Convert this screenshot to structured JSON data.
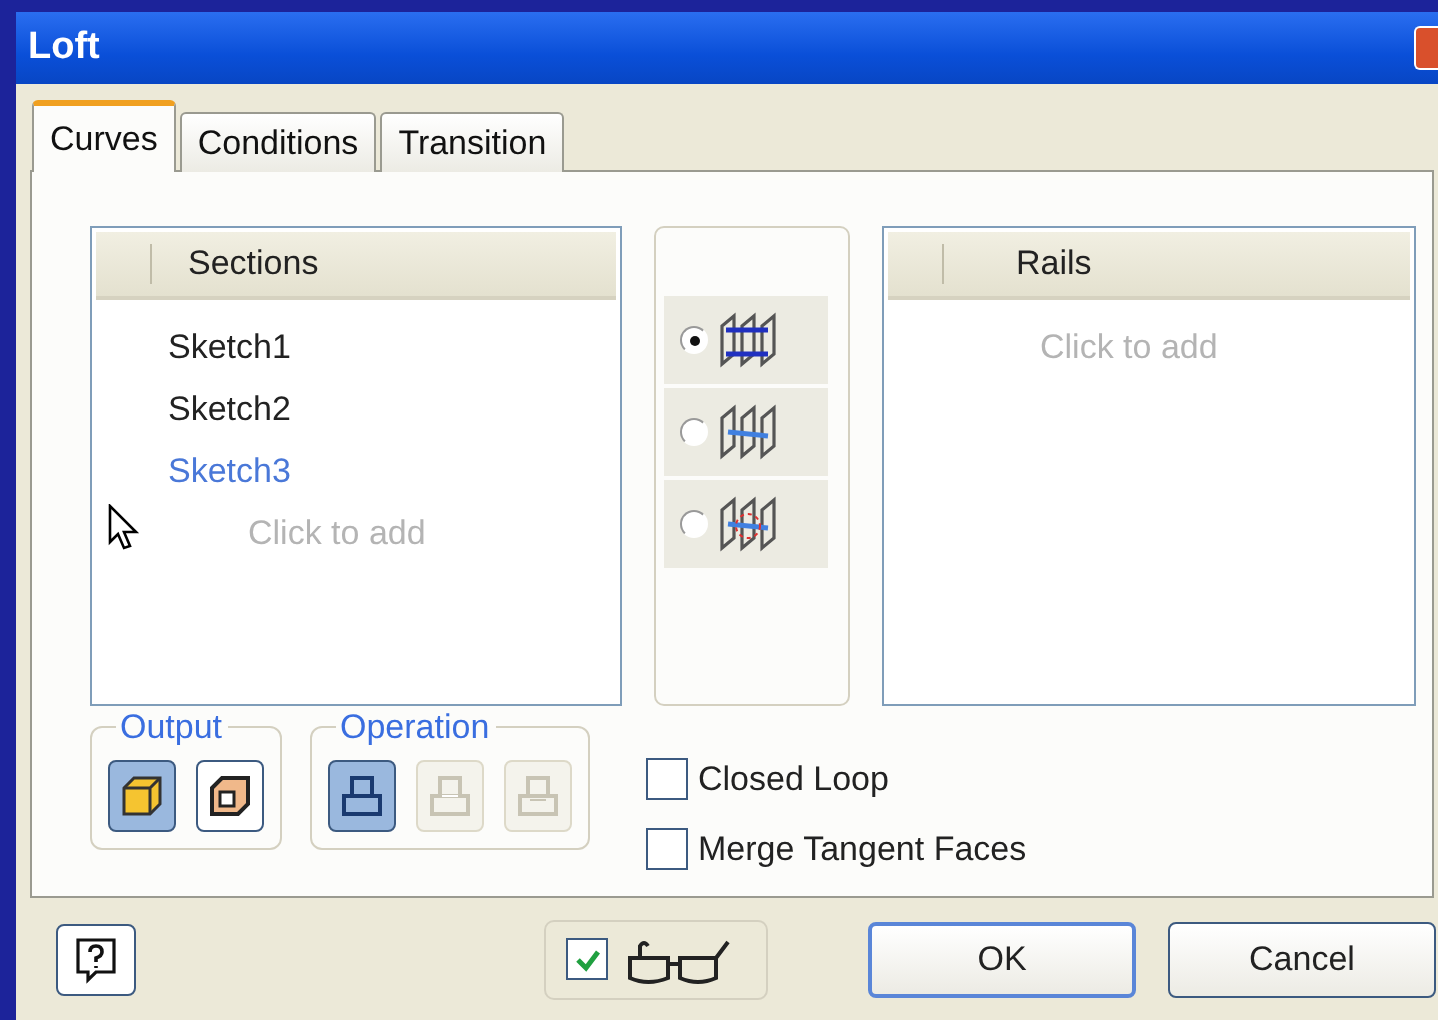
{
  "window": {
    "title": "Loft"
  },
  "tabs": [
    {
      "label": "Curves",
      "selected": true
    },
    {
      "label": "Conditions",
      "selected": false
    },
    {
      "label": "Transition",
      "selected": false
    }
  ],
  "sections": {
    "header": "Sections",
    "items": [
      {
        "label": "Sketch1",
        "selected": false
      },
      {
        "label": "Sketch2",
        "selected": false
      },
      {
        "label": "Sketch3",
        "selected": true
      }
    ],
    "placeholder": "Click to add"
  },
  "loft_types": [
    {
      "kind": "rails",
      "selected": true
    },
    {
      "kind": "centerline",
      "selected": false
    },
    {
      "kind": "area",
      "selected": false
    }
  ],
  "rails": {
    "header": "Rails",
    "placeholder": "Click to add"
  },
  "output": {
    "label": "Output",
    "buttons": [
      {
        "kind": "solid",
        "selected": true
      },
      {
        "kind": "surface",
        "selected": false
      }
    ]
  },
  "operation": {
    "label": "Operation",
    "buttons": [
      {
        "kind": "join",
        "selected": true,
        "disabled": false
      },
      {
        "kind": "cut",
        "selected": false,
        "disabled": true
      },
      {
        "kind": "intersect",
        "selected": false,
        "disabled": true
      }
    ]
  },
  "options": [
    {
      "label": "Closed Loop",
      "checked": false
    },
    {
      "label": "Merge Tangent Faces",
      "checked": false
    }
  ],
  "preview": {
    "checked": true
  },
  "buttons": [
    "OK",
    "Cancel"
  ]
}
